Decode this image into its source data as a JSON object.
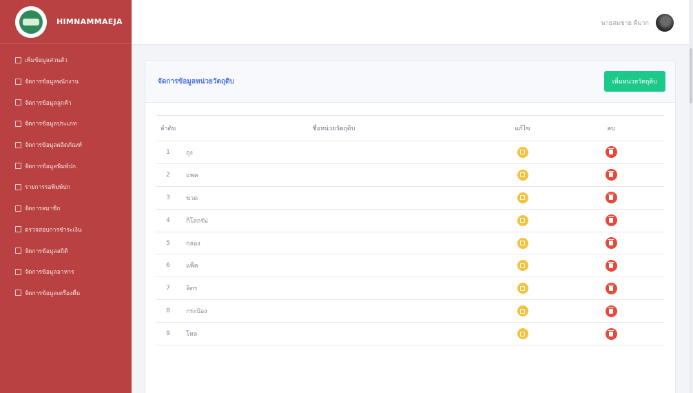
{
  "brand": {
    "title": "HIMNAMMAEJA",
    "logo_icon": "brand-logo-icon"
  },
  "sidebar": {
    "background": "#b94141",
    "items": [
      {
        "label": "เพิ่มข้อมูลส่วนตัว"
      },
      {
        "label": "จัดการข้อมูลพนักงาน"
      },
      {
        "label": "จัดการข้อมูลลูกค้า"
      },
      {
        "label": "จัดการข้อมูลประเภท"
      },
      {
        "label": "จัดการข้อมูลผลิตภัณฑ์"
      },
      {
        "label": "จัดการข้อมูลพิมพ์ปก"
      },
      {
        "label": "รายการรอพิมพ์ปก"
      },
      {
        "label": "จัดการสมาชิก"
      },
      {
        "label": "ตรวจสอบการชำระเงิน"
      },
      {
        "label": "จัดการข้อมูลสถิติ"
      },
      {
        "label": "จัดการข้อมูลอาหาร"
      },
      {
        "label": "จัดการข้อมูลเครื่องดื่ม"
      }
    ]
  },
  "topbar": {
    "user_name": "นายสมชาย ดีมาก"
  },
  "card": {
    "title": "จัดการข้อมูลหน่วยวัตถุดิบ",
    "add_button_label": "เพิ่มหน่วยวัตถุดิบ",
    "accent": "#4e73df",
    "add_color": "#1cc88a"
  },
  "table": {
    "headers": {
      "no": "ลำดับ",
      "name": "ชื่อหน่วยวัตถุดิบ",
      "edit": "แก้ไข",
      "delete": "ลบ"
    },
    "rows": [
      {
        "no": "1",
        "name": "ถุง"
      },
      {
        "no": "2",
        "name": "แพค"
      },
      {
        "no": "3",
        "name": "ขวด"
      },
      {
        "no": "4",
        "name": "กิโลกรัม"
      },
      {
        "no": "5",
        "name": "กล่อง"
      },
      {
        "no": "6",
        "name": "แพ็ค"
      },
      {
        "no": "7",
        "name": "ลิตร"
      },
      {
        "no": "8",
        "name": "กระป๋อง"
      },
      {
        "no": "9",
        "name": "โหล"
      }
    ],
    "edit_icon": "edit-icon",
    "delete_icon": "trash-icon",
    "edit_color": "#f6c23e",
    "delete_color": "#e74a3b"
  }
}
